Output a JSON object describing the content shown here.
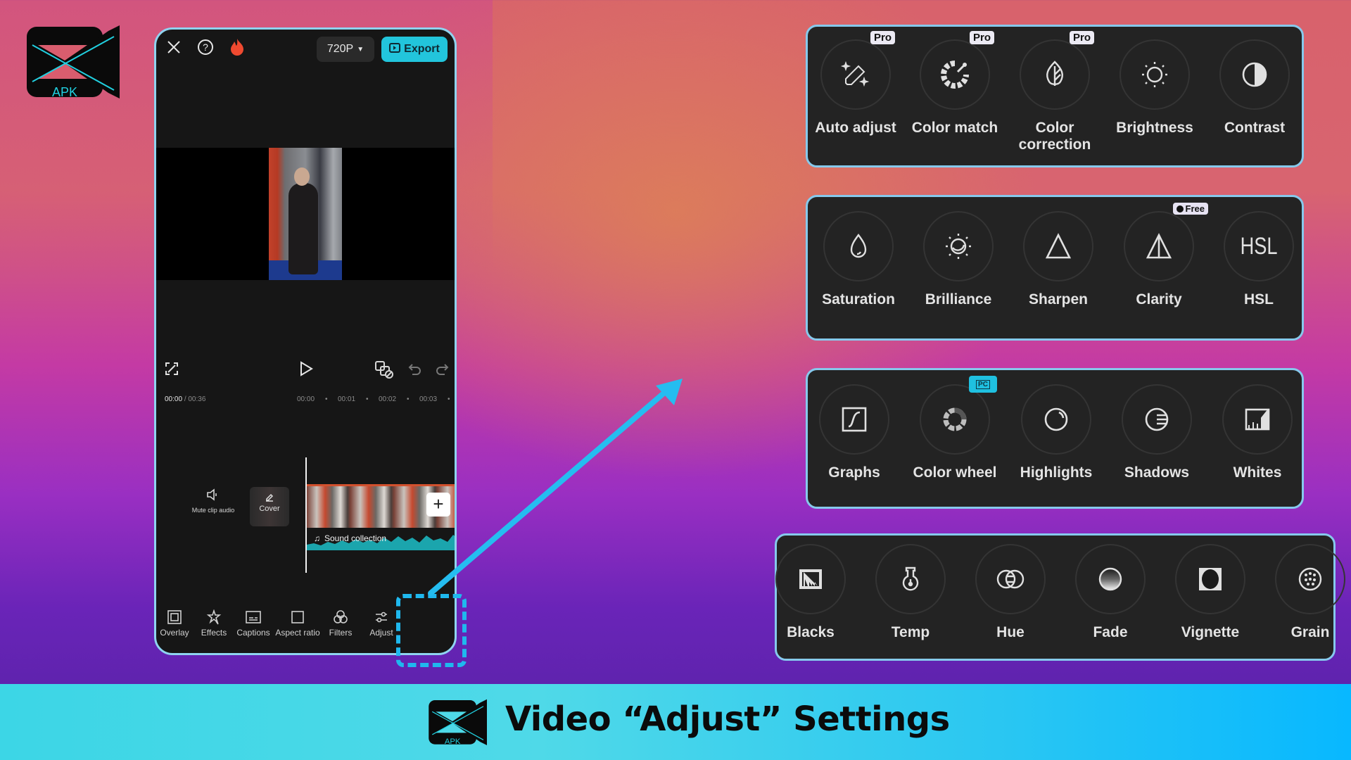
{
  "brand": {
    "logo_text": "APK"
  },
  "phone": {
    "top_bar": {
      "close_icon": "close-icon",
      "help_icon": "help-icon",
      "trend_icon": "flame-icon",
      "resolution": "720P",
      "export_label": "Export"
    },
    "timecode": {
      "current": "00:00",
      "total": "/ 00:36"
    },
    "ruler": [
      "00:00",
      "00:01",
      "00:02",
      "00:03"
    ],
    "track": {
      "mute_label": "Mute clip audio",
      "cover_label": "Cover",
      "add_label": "+",
      "audio_label": "Sound collection"
    },
    "toolbar": [
      {
        "label": "Overlay",
        "icon": "overlay-icon"
      },
      {
        "label": "Effects",
        "icon": "effects-icon"
      },
      {
        "label": "Captions",
        "icon": "captions-icon"
      },
      {
        "label": "Aspect ratio",
        "icon": "aspect-ratio-icon"
      },
      {
        "label": "Filters",
        "icon": "filters-icon"
      },
      {
        "label": "Adjust",
        "icon": "adjust-icon",
        "highlighted": true
      }
    ]
  },
  "panels": [
    {
      "options": [
        {
          "label": "Auto adjust",
          "badge": "Pro"
        },
        {
          "label": "Color match",
          "badge": "Pro"
        },
        {
          "label": "Color correction",
          "badge": "Pro"
        },
        {
          "label": "Brightness"
        },
        {
          "label": "Contrast"
        }
      ]
    },
    {
      "options": [
        {
          "label": "Saturation"
        },
        {
          "label": "Brilliance"
        },
        {
          "label": "Sharpen"
        },
        {
          "label": "Clarity",
          "badge": "Free"
        },
        {
          "label": "HSL",
          "icon_text": "HSL"
        }
      ]
    },
    {
      "options": [
        {
          "label": "Graphs"
        },
        {
          "label": "Color wheel",
          "badge": "PC"
        },
        {
          "label": "Highlights"
        },
        {
          "label": "Shadows"
        },
        {
          "label": "Whites"
        }
      ]
    },
    {
      "options": [
        {
          "label": "Blacks"
        },
        {
          "label": "Temp"
        },
        {
          "label": "Hue"
        },
        {
          "label": "Fade"
        },
        {
          "label": "Vignette"
        },
        {
          "label": "Grain"
        }
      ]
    }
  ],
  "footer": {
    "title": "Video “Adjust” Settings",
    "logo_text": "APK"
  },
  "colors": {
    "accent": "#22c5dc",
    "panel_border": "#86c9ec",
    "dash": "#1fb8ee",
    "panel_bg": "#232323"
  }
}
